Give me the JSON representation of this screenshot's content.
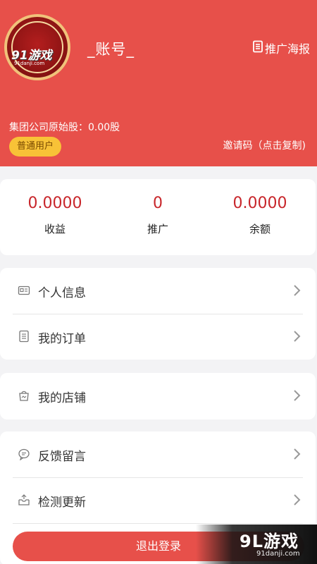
{
  "header": {
    "avatar_watermark": "91游戏",
    "avatar_watermark_url": "91danji.com",
    "account_label": "_账号_",
    "poster_label": "推广海报",
    "shares_text": "集团公司原始股：0.00股",
    "user_badge": "普通用户",
    "invite_label": "邀请码（点击复制)"
  },
  "stats": [
    {
      "value": "0.0000",
      "label": "收益"
    },
    {
      "value": "0",
      "label": "推广"
    },
    {
      "value": "0.0000",
      "label": "余额"
    }
  ],
  "menu": {
    "personal_info": "个人信息",
    "my_orders": "我的订单",
    "my_store": "我的店铺",
    "feedback": "反馈留言",
    "check_update": "检测更新"
  },
  "logout_label": "退出登录",
  "watermark": {
    "brand": "9L游戏",
    "url": "91danji.com"
  },
  "colors": {
    "header_red": "#e7504a",
    "value_red": "#c8262b",
    "badge_yellow": "#f8c237"
  }
}
